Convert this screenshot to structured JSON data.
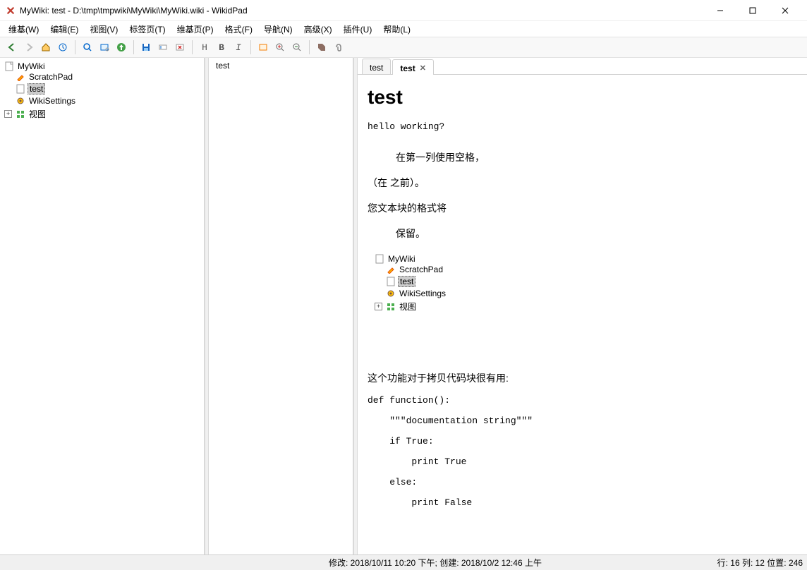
{
  "window": {
    "title": "MyWiki: test - D:\\tmp\\tmpwiki\\MyWiki\\MyWiki.wiki - WikidPad"
  },
  "menu": {
    "wiki": "维基(W)",
    "edit": "编辑(E)",
    "view": "视图(V)",
    "tabs": "标签页(T)",
    "wikipage": "维基页(P)",
    "format": "格式(F)",
    "navigate": "导航(N)",
    "advanced": "高级(X)",
    "plugins": "插件(U)",
    "help": "帮助(L)"
  },
  "toolbar_fmt": {
    "h": "H",
    "b": "B",
    "i": "I"
  },
  "tree": {
    "root": "MyWiki",
    "items": [
      "ScratchPad",
      "test",
      "WikiSettings"
    ],
    "views": "视图"
  },
  "list": {
    "item0": "test"
  },
  "tabs": {
    "t0": "test",
    "t1": "test"
  },
  "doc": {
    "heading": "test",
    "hello": "hello working?",
    "cn1": "在第一列使用空格，",
    "cn2": "（在 之前）。",
    "cn3": "您文本块的格式将",
    "cn4": "保留。",
    "cn5": "这个功能对于拷贝代码块很有用:",
    "code1": "def function():",
    "code2": "    \"\"\"documentation string\"\"\"",
    "code3": "    if True:",
    "code4": "        print True",
    "code5": "    else:",
    "code6": "        print False"
  },
  "status": {
    "mid": "修改: 2018/10/11 10:20 下午; 创建: 2018/10/2 12:46 上午",
    "right": "行: 16 列: 12 位置: 246"
  }
}
